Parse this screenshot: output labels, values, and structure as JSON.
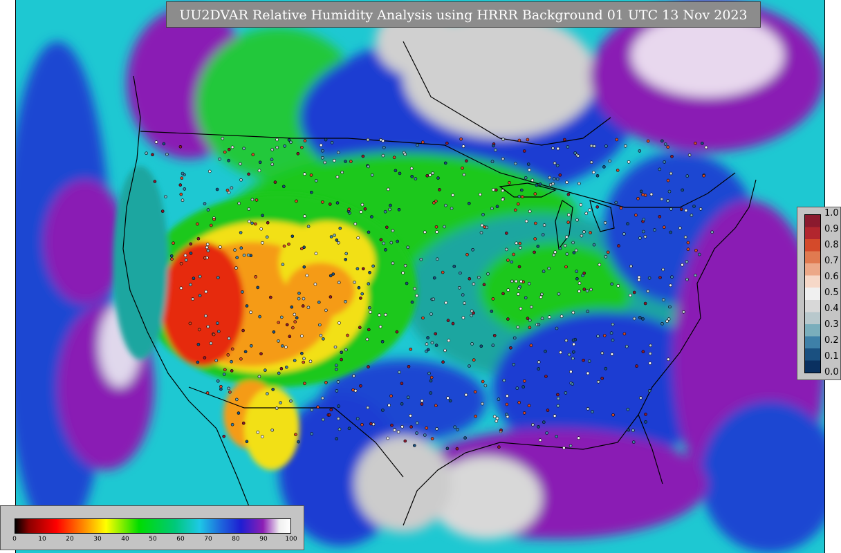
{
  "title": "UU2DVAR Relative Humidity Analysis using HRRR Background 01 UTC 13 Nov 2023",
  "colors": {
    "panel_bg": "#c4c4c4",
    "title_bg": "#8c8c8c",
    "land_dry": "#e62a0a",
    "land_orange": "#f59b12",
    "land_yellow": "#f2e018",
    "land_green": "#1ec81e",
    "land_teal": "#1aa6a0",
    "moist_blue": "#1e3cd2",
    "very_moist_purple": "#8a1eb4",
    "saturated_white": "#e6e6e6",
    "ocean_cyan": "#1ec8d2"
  },
  "rh_colorbar": {
    "units": "percent",
    "ticks": [
      "0",
      "10",
      "20",
      "30",
      "40",
      "50",
      "60",
      "70",
      "80",
      "90",
      "100"
    ],
    "stops": [
      {
        "value": 0,
        "color": "#000000"
      },
      {
        "value": 5,
        "color": "#8b0000"
      },
      {
        "value": 15,
        "color": "#ff0000"
      },
      {
        "value": 25,
        "color": "#ff8c00"
      },
      {
        "value": 33,
        "color": "#ffff00"
      },
      {
        "value": 45,
        "color": "#00dc00"
      },
      {
        "value": 58,
        "color": "#00c87a"
      },
      {
        "value": 67,
        "color": "#1ec8e6"
      },
      {
        "value": 75,
        "color": "#1e64dc"
      },
      {
        "value": 82,
        "color": "#1e1ed2"
      },
      {
        "value": 90,
        "color": "#8c1eb4"
      },
      {
        "value": 96,
        "color": "#f0f0f0"
      },
      {
        "value": 100,
        "color": "#ffffff"
      }
    ]
  },
  "obs_colorbar": {
    "ticks": [
      "1.0",
      "0.9",
      "0.8",
      "0.7",
      "0.6",
      "0.5",
      "0.4",
      "0.3",
      "0.2",
      "0.1",
      "0.0"
    ],
    "bands": [
      "#8b1a2e",
      "#b2262e",
      "#d44a2a",
      "#e07a50",
      "#eca888",
      "#f6d8c8",
      "#f0f0f0",
      "#d8d8d8",
      "#b8c8cc",
      "#7aaebc",
      "#3e80a8",
      "#1a5080",
      "#0a3060"
    ]
  },
  "observation_stations": {
    "count_drawn": 900,
    "colors": [
      "#8b1a2e",
      "#d44a2a",
      "#f0f0f0",
      "#b8c8cc",
      "#7aaebc",
      "#3e80a8",
      "#1a5080"
    ]
  }
}
